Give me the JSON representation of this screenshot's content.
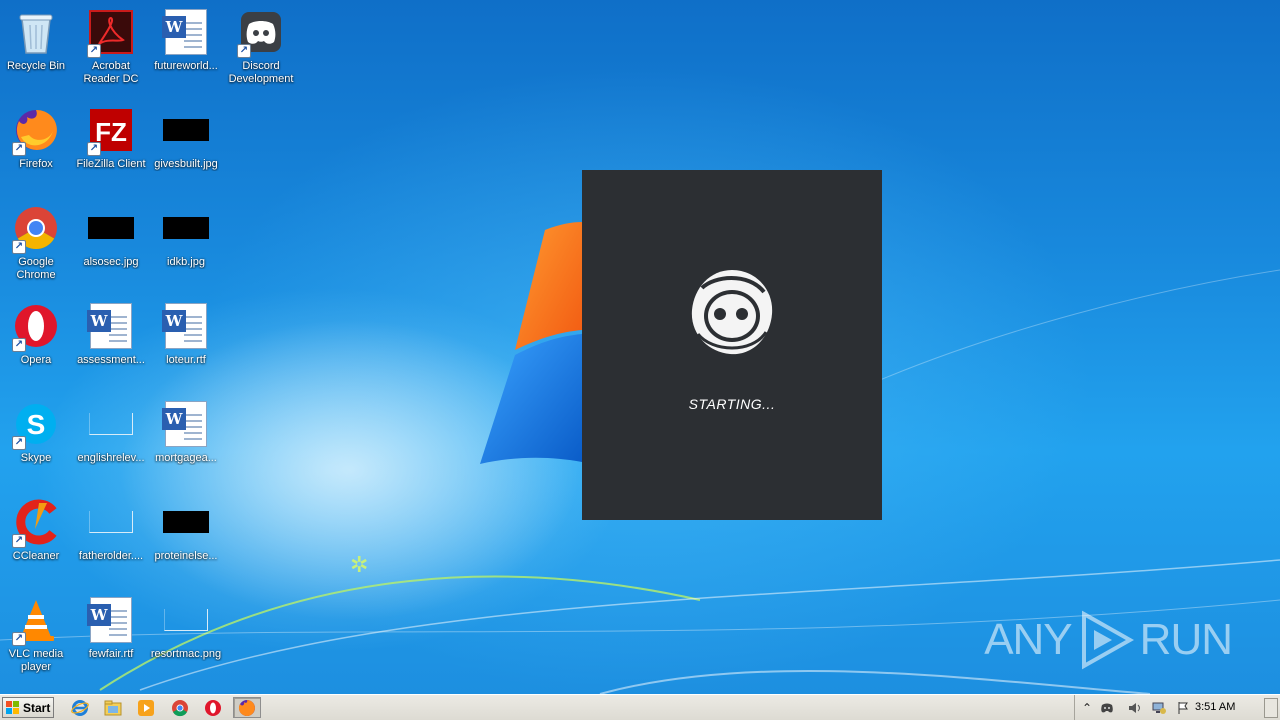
{
  "desktop": {
    "icons": [
      {
        "label": "Recycle Bin"
      },
      {
        "label": "Acrobat Reader DC"
      },
      {
        "label": "futureworld..."
      },
      {
        "label": "Discord Development"
      },
      {
        "label": "Firefox"
      },
      {
        "label": "FileZilla Client"
      },
      {
        "label": "givesbuilt.jpg"
      },
      {
        "label": "Google Chrome"
      },
      {
        "label": "alsosec.jpg"
      },
      {
        "label": "idkb.jpg"
      },
      {
        "label": "Opera"
      },
      {
        "label": "assessment..."
      },
      {
        "label": "loteur.rtf"
      },
      {
        "label": "Skype"
      },
      {
        "label": "englishrelev..."
      },
      {
        "label": "mortgagea..."
      },
      {
        "label": "CCleaner"
      },
      {
        "label": "fatherolder...."
      },
      {
        "label": "proteinelse..."
      },
      {
        "label": "VLC media player"
      },
      {
        "label": "fewfair.rtf"
      },
      {
        "label": "resortmac.png"
      }
    ]
  },
  "splash": {
    "status": "STARTING..."
  },
  "watermark": {
    "left": "ANY",
    "right": "RUN"
  },
  "taskbar": {
    "start_label": "Start",
    "clock": "3:51 AM",
    "pinned": [
      "internet-explorer-icon",
      "file-explorer-icon",
      "media-player-icon",
      "chrome-icon",
      "opera-icon",
      "firefox-icon"
    ]
  },
  "colors": {
    "splash_bg": "#2c2f33",
    "taskbar_bg": "#dddbd3"
  }
}
